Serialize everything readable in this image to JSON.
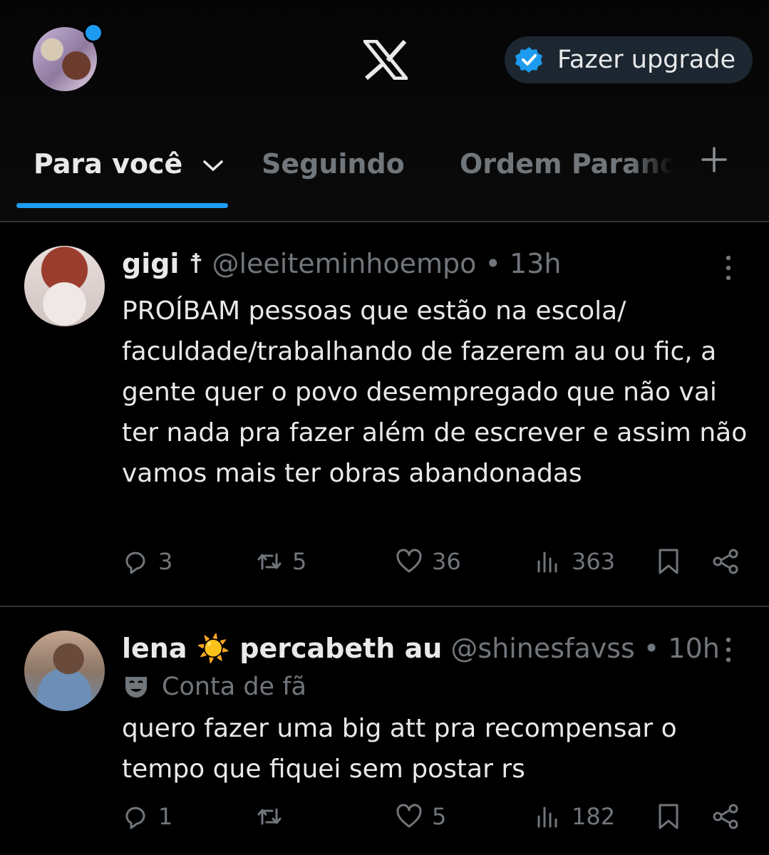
{
  "header": {
    "upgrade_label": "Fazer upgrade",
    "accent_color": "#1d9bf0"
  },
  "tabs": [
    {
      "label": "Para você",
      "active": true
    },
    {
      "label": "Seguindo",
      "active": false
    },
    {
      "label": "Ordem Paranor",
      "active": false
    }
  ],
  "tweets": [
    {
      "name": "gigi ☨",
      "handle": "@leeiteminhoempo",
      "separator": "•",
      "time": "13h",
      "label": "",
      "text": "PROÍBAM pessoas que estão na escola/ faculdade/trabalhando de fazerem au ou fic, a gente quer o povo desempregado que não vai ter nada pra fazer além de escrever e assim não vamos mais ter obras abandonadas",
      "replies": "3",
      "retweets": "5",
      "likes": "36",
      "views": "363"
    },
    {
      "name": "lena ☀️ percabeth au",
      "handle": "@shinesfavss",
      "separator": "•",
      "time": "10h",
      "label": "Conta de fã",
      "text": "quero fazer uma big att pra recompensar o tempo que fiquei sem postar rs",
      "replies": "1",
      "retweets": "",
      "likes": "5",
      "views": "182"
    }
  ]
}
